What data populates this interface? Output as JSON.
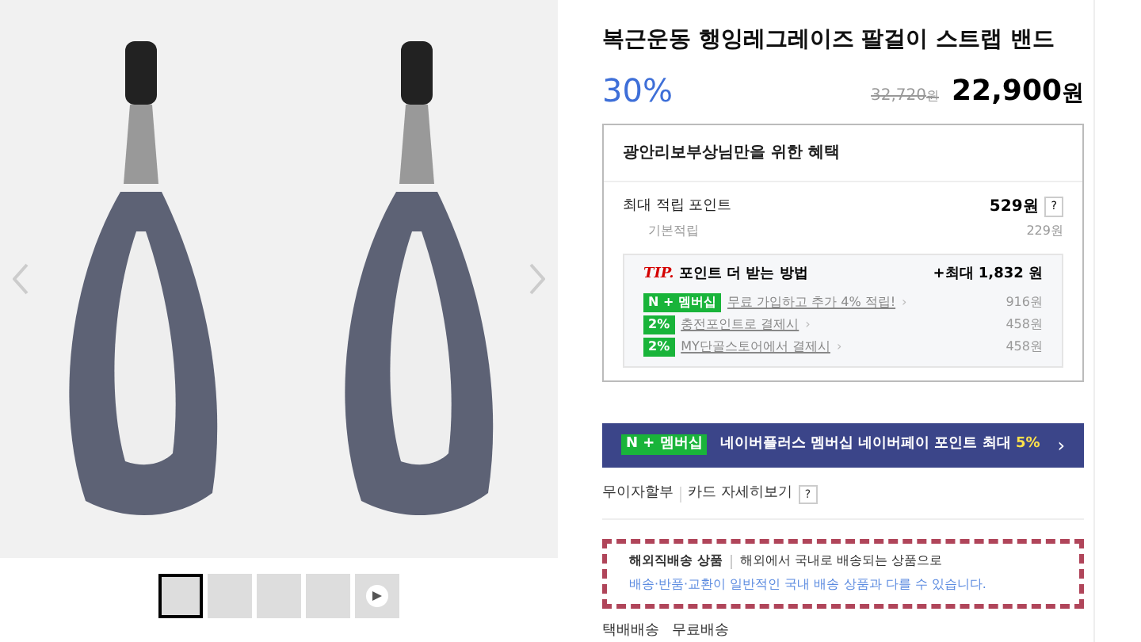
{
  "gallery": {
    "thumbnails": [
      {
        "kind": "photo",
        "selected": true
      },
      {
        "kind": "photo",
        "selected": false
      },
      {
        "kind": "photo",
        "selected": false
      },
      {
        "kind": "photo",
        "selected": false
      },
      {
        "kind": "video",
        "selected": false
      }
    ]
  },
  "product": {
    "title": "복근운동 행잉레그레이즈 팔걸이 스트랩 밴드",
    "discount": "30%",
    "original_price": "32,720",
    "original_unit": "원",
    "price": "22,900",
    "price_unit": "원"
  },
  "benefits": {
    "title": "광안리보부상님만을 위한 혜택",
    "max_points_label": "최대 적립 포인트",
    "max_points": "529원",
    "help": "?",
    "base_label": "기본적립",
    "base_points": "229원",
    "tip": {
      "prefix": "TIP.",
      "title": "포인트 더 받는 방법",
      "total": "+최대 1,832 원",
      "items": [
        {
          "badge": "N + 멤버십",
          "label": "무료 가입하고 추가 4% 적립!",
          "amount": "916원"
        },
        {
          "badge": "2%",
          "label": "충전포인트로 결제시",
          "amount": "458원"
        },
        {
          "badge": "2%",
          "label": "MY단골스토어에서 결제시",
          "amount": "458원"
        }
      ]
    }
  },
  "membership_banner": {
    "badge": "N + 멤버십",
    "text": "네이버플러스 멤버십 네이버페이 포인트 최대",
    "highlight": "5%",
    "arrow": "›"
  },
  "installment": {
    "label": "무이자할부",
    "link": "카드 자세히보기",
    "help": "?"
  },
  "overseas": {
    "title": "해외직배송 상품",
    "line1": "해외에서 국내로 배송되는 상품으로",
    "line2": "배송·반품·교환이 일반적인 국내 배송 상품과 다를 수 있습니다."
  },
  "shipping": {
    "method": "택배배송",
    "fee": "무료배송"
  }
}
